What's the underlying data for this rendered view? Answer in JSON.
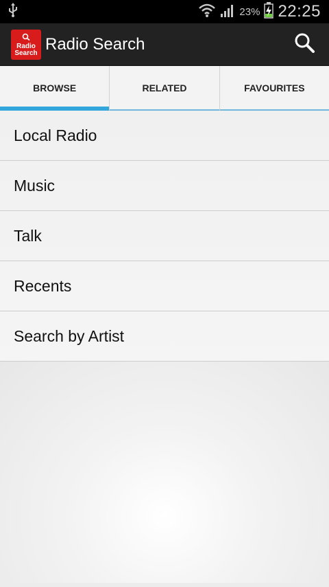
{
  "status_bar": {
    "battery_percent": "23%",
    "time": "22:25"
  },
  "action_bar": {
    "logo_line1": "Radio",
    "logo_line2": "Search",
    "title": "Radio Search"
  },
  "tabs": [
    {
      "label": "BROWSE",
      "active": true
    },
    {
      "label": "RELATED",
      "active": false
    },
    {
      "label": "FAVOURITES",
      "active": false
    }
  ],
  "list_items": [
    {
      "label": "Local Radio"
    },
    {
      "label": "Music"
    },
    {
      "label": "Talk"
    },
    {
      "label": "Recents"
    },
    {
      "label": "Search by Artist"
    }
  ],
  "colors": {
    "accent": "#33a7dc",
    "logo_red": "#d81b1b",
    "action_bar": "#222222"
  }
}
